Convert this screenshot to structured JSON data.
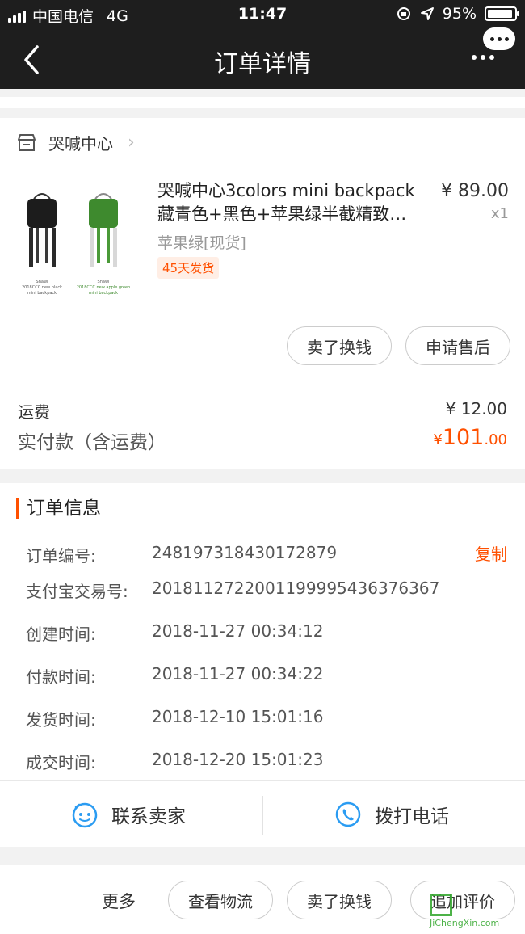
{
  "status_bar": {
    "carrier": "中国电信",
    "network": "4G",
    "time": "11:47",
    "battery": "95%"
  },
  "nav": {
    "title": "订单详情",
    "back_icon": "chevron-left-icon",
    "more_icon": "message-bubble-icon"
  },
  "order": {
    "store_name": "哭喊中心",
    "store_icon": "store-icon",
    "product": {
      "title_line1": "哭喊中心3colors mini backpack",
      "title_line2": "藏青色+黑色+苹果绿半截精致…",
      "price": "¥ 89.00",
      "quantity": "x1",
      "sku": "苹果绿[现货]",
      "tag": "45天发货"
    },
    "actions": {
      "sell": "卖了换钱",
      "after_sale": "申请售后"
    },
    "shipping_label": "运费",
    "shipping_value": "¥ 12.00",
    "total_label": "实付款（含运费）",
    "total_currency": "¥",
    "total_int": "101",
    "total_dec": ".00"
  },
  "info": {
    "title": "订单信息",
    "copy_label": "复制",
    "rows": [
      {
        "key": "订单编号:",
        "value": "248197318430172879"
      },
      {
        "key": "支付宝交易号:",
        "value": "2018112722001199995436376367"
      },
      {
        "key": "创建时间:",
        "value": "2018-11-27 00:34:12"
      },
      {
        "key": "付款时间:",
        "value": "2018-11-27 00:34:22"
      },
      {
        "key": "发货时间:",
        "value": "2018-12-10 15:01:16"
      },
      {
        "key": "成交时间:",
        "value": "2018-12-20 15:01:23"
      }
    ]
  },
  "contact": {
    "seller": "联系卖家",
    "phone": "拨打电话"
  },
  "bottom": {
    "more": "更多",
    "logistics": "查看物流",
    "sell": "卖了换钱",
    "review": "追加评价"
  },
  "watermark": {
    "site": "JiChengXin.com"
  },
  "colors": {
    "accent": "#ff5000",
    "nav_bg": "#1e1e1e",
    "contact_icon": "#2b9cf2"
  }
}
